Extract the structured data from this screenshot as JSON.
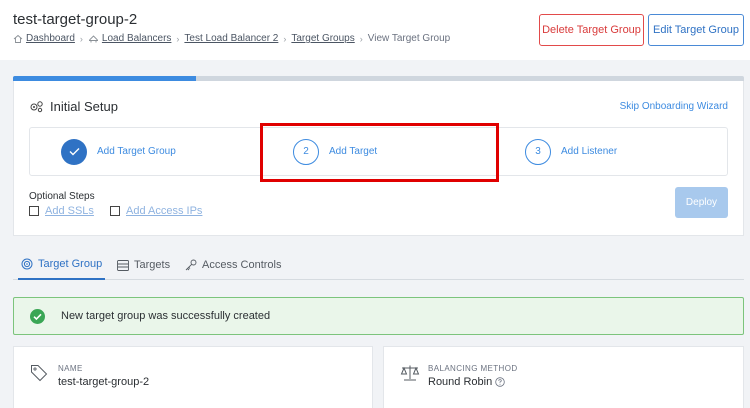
{
  "header": {
    "title": "test-target-group-2",
    "breadcrumb": [
      {
        "label": "Dashboard"
      },
      {
        "label": "Load Balancers"
      },
      {
        "label": "Test Load Balancer 2"
      },
      {
        "label": "Target Groups"
      },
      {
        "label": "View Target Group"
      }
    ],
    "delete_label": "Delete Target Group",
    "edit_label": "Edit Target Group"
  },
  "setup": {
    "progress_fraction": 0.25,
    "title": "Initial Setup",
    "skip_label": "Skip Onboarding Wizard",
    "steps": [
      {
        "number": "",
        "label": "Add Target Group",
        "done": true
      },
      {
        "number": "2",
        "label": "Add Target",
        "done": false
      },
      {
        "number": "3",
        "label": "Add Listener",
        "done": false
      }
    ],
    "optional_label": "Optional Steps",
    "optional": [
      {
        "label": "Add SSLs"
      },
      {
        "label": "Add Access IPs"
      }
    ],
    "deploy_label": "Deploy"
  },
  "tabs": [
    {
      "label": "Target Group",
      "active": true
    },
    {
      "label": "Targets",
      "active": false
    },
    {
      "label": "Access Controls",
      "active": false
    }
  ],
  "alert": {
    "message": "New target group was successfully created"
  },
  "details": {
    "name_label": "NAME",
    "name_value": "test-target-group-2",
    "method_label": "BALANCING METHOD",
    "method_value": "Round Robin"
  },
  "colors": {
    "accent": "#2f72c4",
    "danger": "#d93b3b",
    "success": "#3aa655",
    "highlight": "#e00000"
  }
}
